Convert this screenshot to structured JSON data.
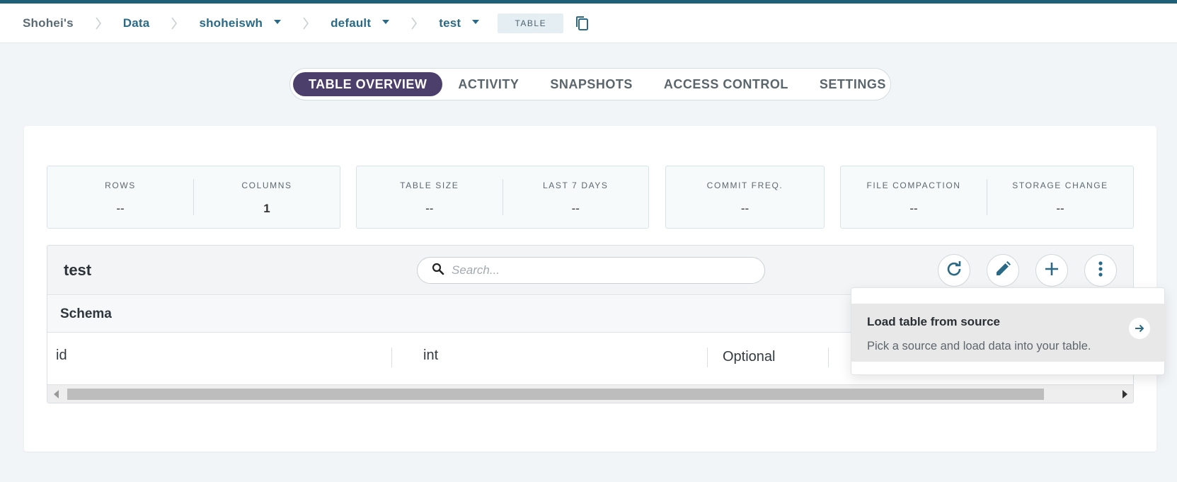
{
  "breadcrumb": {
    "items": [
      {
        "label": "Shohei's"
      },
      {
        "label": "Data"
      },
      {
        "label": "shoheiswh"
      },
      {
        "label": "default"
      },
      {
        "label": "test"
      }
    ],
    "type_badge": "TABLE"
  },
  "tabs": [
    {
      "label": "TABLE OVERVIEW",
      "active": true
    },
    {
      "label": "ACTIVITY"
    },
    {
      "label": "SNAPSHOTS"
    },
    {
      "label": "ACCESS CONTROL"
    },
    {
      "label": "SETTINGS"
    }
  ],
  "stats": {
    "rows": {
      "label": "ROWS",
      "value": "--"
    },
    "columns": {
      "label": "COLUMNS",
      "value": "1"
    },
    "table_size": {
      "label": "TABLE SIZE",
      "value": "--"
    },
    "last_7_days": {
      "label": "LAST 7 DAYS",
      "value": "--"
    },
    "commit_freq": {
      "label": "COMMIT FREQ.",
      "value": "--"
    },
    "file_compaction": {
      "label": "FILE COMPACTION",
      "value": "--"
    },
    "storage_change": {
      "label": "STORAGE CHANGE",
      "value": "--"
    }
  },
  "table_panel": {
    "title": "test",
    "search_placeholder": "Search...",
    "schema_label": "Schema",
    "rows": [
      {
        "name": "id",
        "type": "int",
        "nullability": "Optional"
      }
    ]
  },
  "dropdown": {
    "item_title": "Load table from source",
    "item_description": "Pick a source and load data into your table."
  },
  "colors": {
    "accent": "#1f5f78",
    "active_tab": "#4d3f6c",
    "link": "#2a6a86"
  }
}
